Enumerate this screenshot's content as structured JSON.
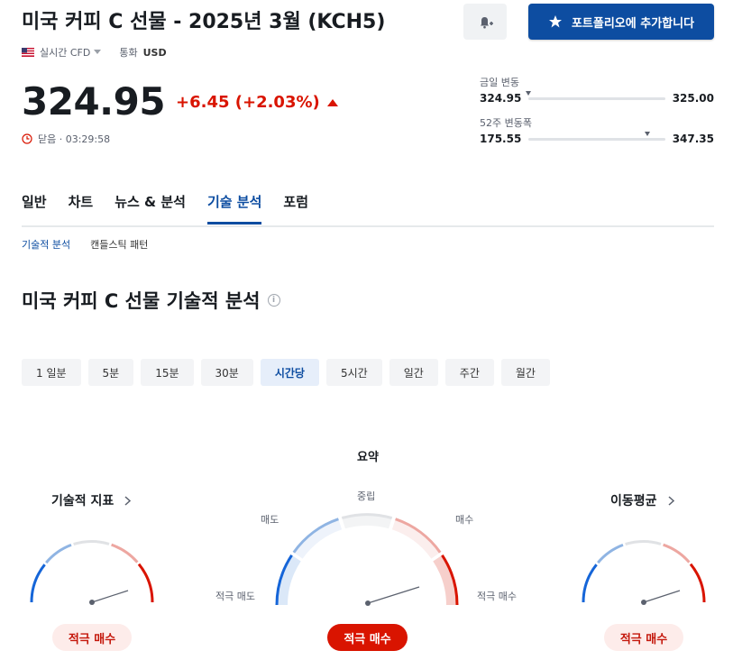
{
  "header": {
    "title": "미국 커피 C 선물 - 2025년 3월 (KCH5)",
    "portfolio_button": "포트폴리오에 추가합니다",
    "realtime_label": "실시간 CFD",
    "currency_label": "통화",
    "currency": "USD"
  },
  "quote": {
    "price": "324.95",
    "change": "+6.45 (+2.03%)",
    "status": "닫음 · 03:29:58",
    "day_range": {
      "label": "금일 변동",
      "low": "324.95",
      "high": "325.00",
      "position": 0.0
    },
    "week52_range": {
      "label": "52주 변동폭",
      "low": "175.55",
      "high": "347.35",
      "position": 0.87
    }
  },
  "tabs": [
    "일반",
    "차트",
    "뉴스 & 분석",
    "기술 분석",
    "포럼"
  ],
  "active_tab": 3,
  "subtabs": [
    "기술적 분석",
    "캔들스틱 패턴"
  ],
  "section_title": "미국 커피 C 선물 기술적 분석",
  "periods": [
    "1 일분",
    "5분",
    "15분",
    "30분",
    "시간당",
    "5시간",
    "일간",
    "주간",
    "월간"
  ],
  "active_period": 4,
  "summary": {
    "title": "요약",
    "labels": {
      "strong_sell": "적극 매도",
      "sell": "매도",
      "neutral": "중립",
      "buy": "매수",
      "strong_buy": "적극 매수"
    },
    "result": "적극 매수"
  },
  "indicators": {
    "title": "기술적 지표",
    "result": "적극 매수"
  },
  "moving_averages": {
    "title": "이동평균",
    "result": "적극 매수"
  },
  "colors": {
    "accent": "#0d4da1",
    "up": "#d91400",
    "sell": "#1a66cc",
    "buy": "#d91400"
  }
}
